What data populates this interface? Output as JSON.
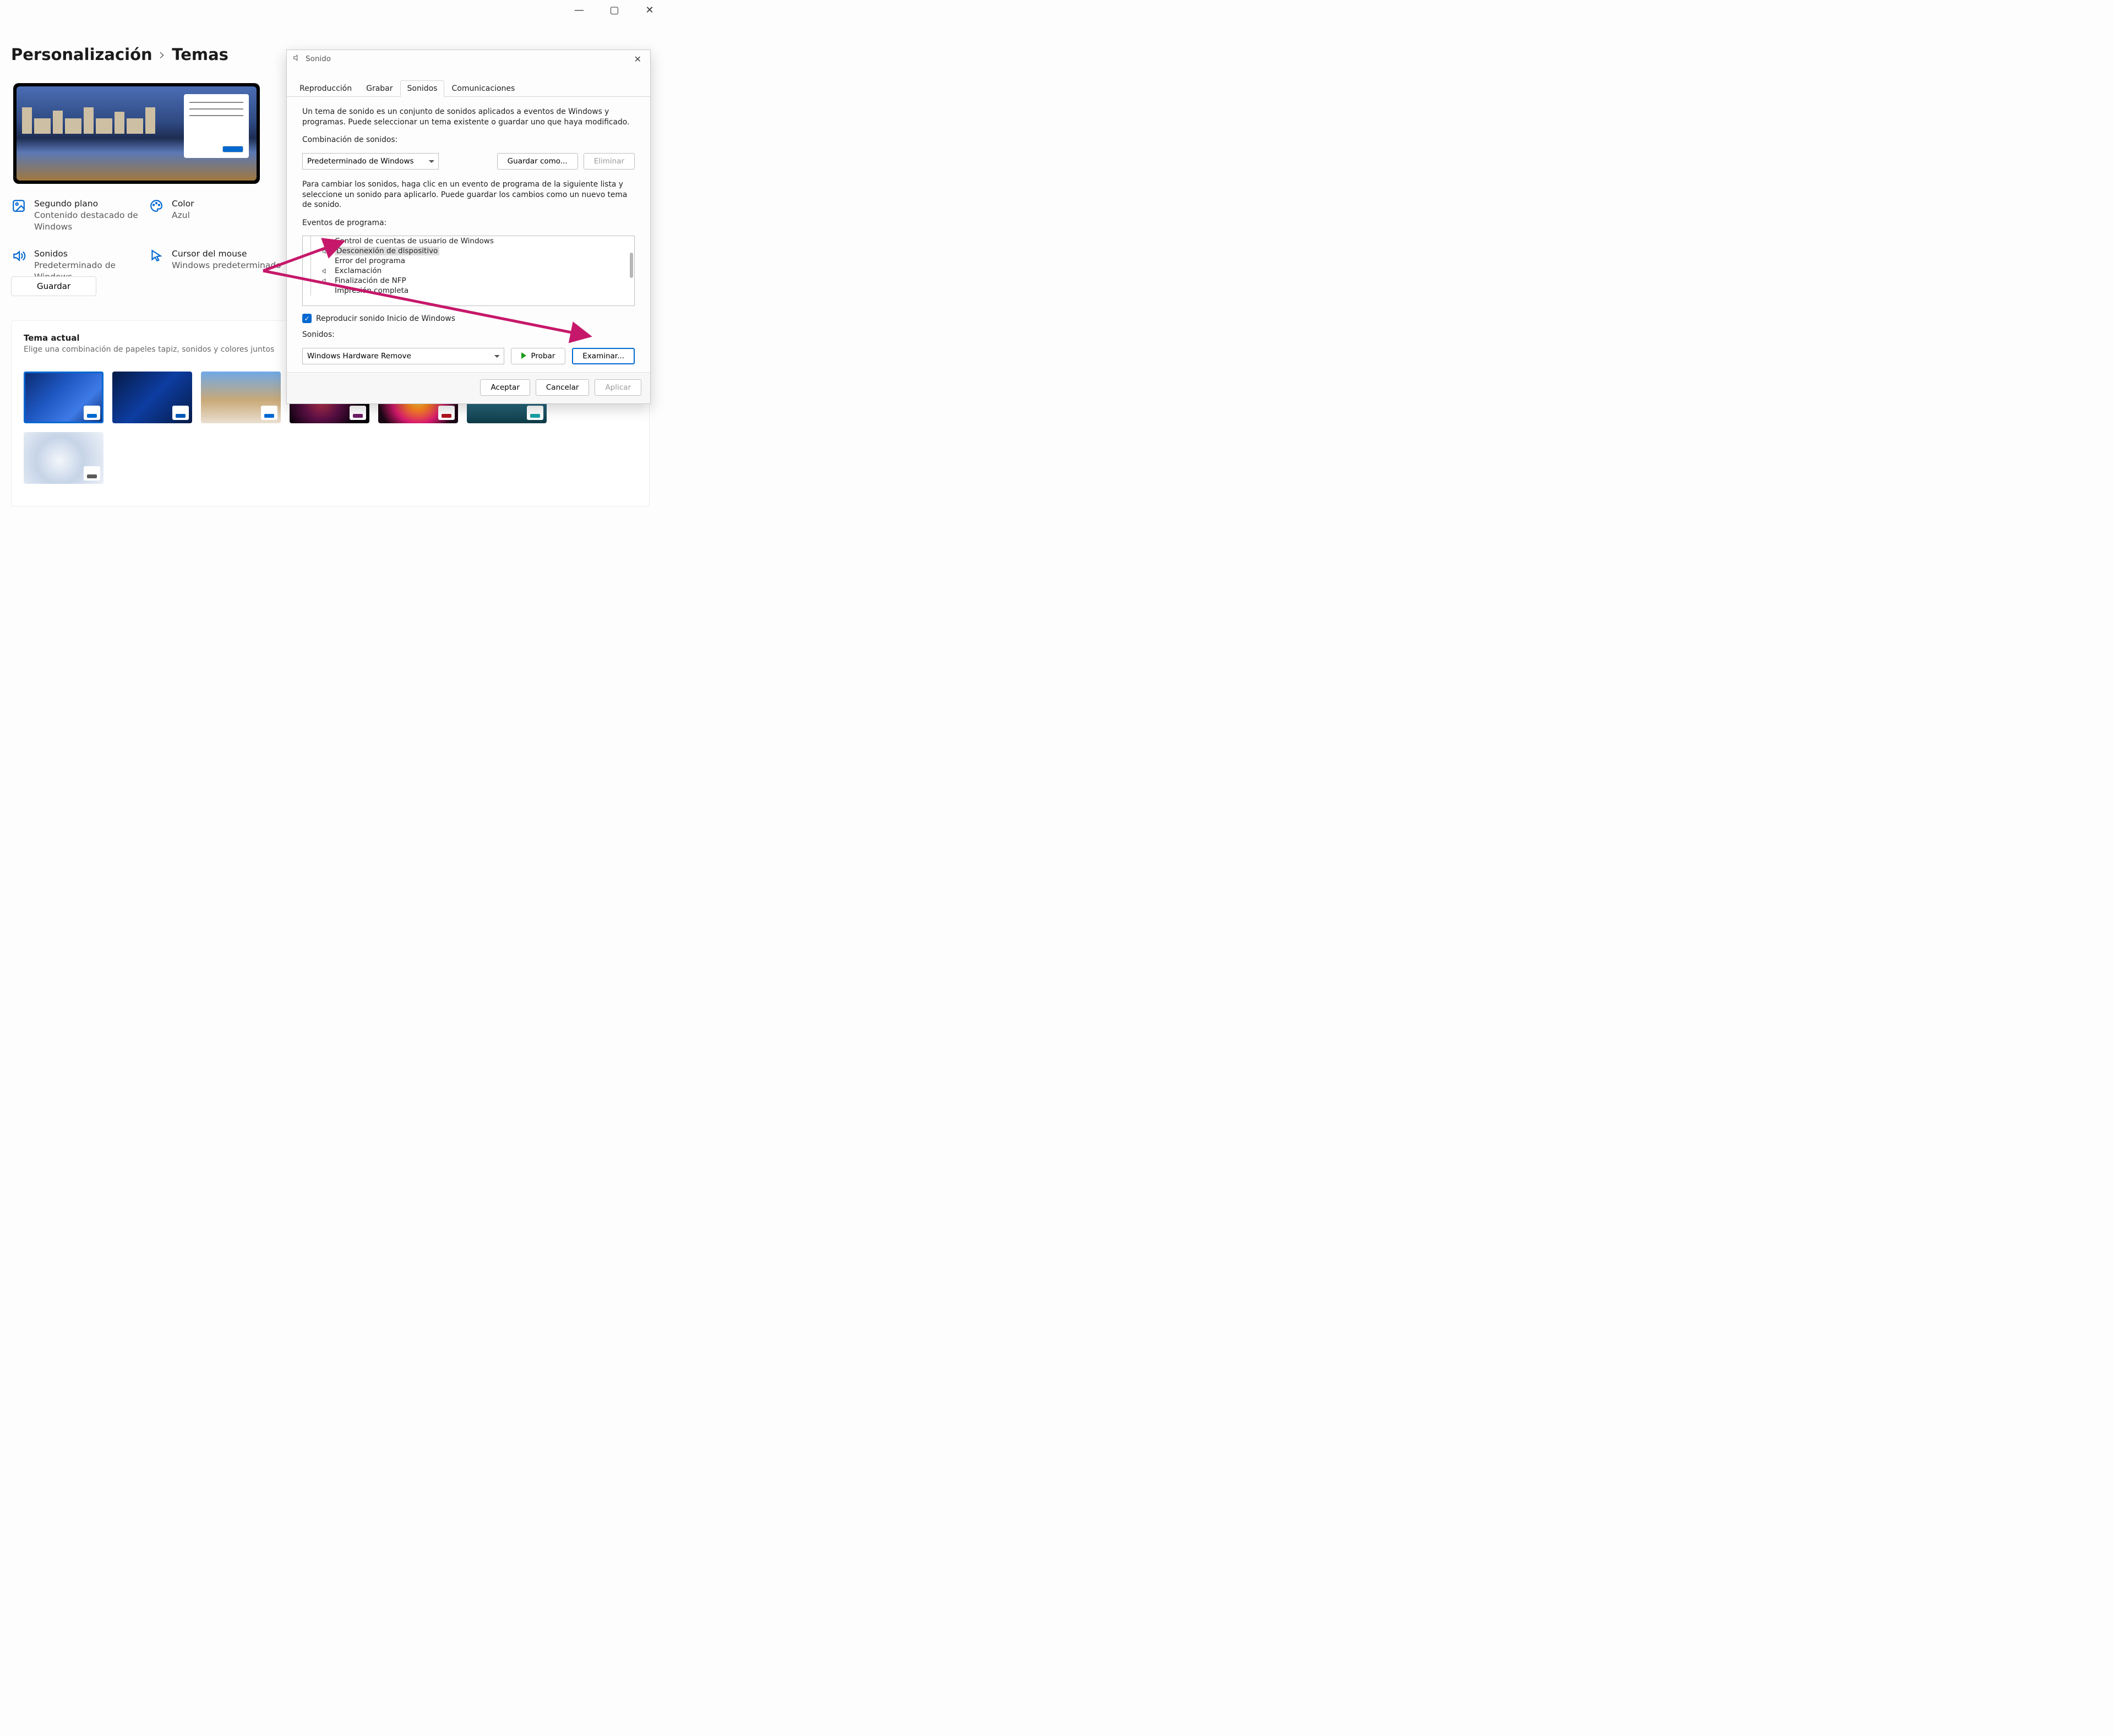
{
  "window_controls": {
    "minimize": "—",
    "maximize": "▢",
    "close": "✕"
  },
  "breadcrumb": {
    "parent": "Personalización",
    "sep": "›",
    "current": "Temas"
  },
  "options": {
    "background": {
      "title": "Segundo plano",
      "value": "Contenido destacado de Windows"
    },
    "color": {
      "title": "Color",
      "value": "Azul"
    },
    "sounds": {
      "title": "Sonidos",
      "value": "Predeterminado de Windows"
    },
    "cursor": {
      "title": "Cursor del mouse",
      "value": "Windows predeterminado"
    }
  },
  "save_button": "Guardar",
  "current_theme": {
    "heading": "Tema actual",
    "sub": "Elige una combinación de papeles tapiz, sonidos y colores juntos"
  },
  "themes": [
    {
      "accent": "#0168d0",
      "bg": "linear-gradient(135deg,#0a2a6e,#1f57c2 40%,#3e7ae6 70%,#0a2a6e)"
    },
    {
      "accent": "#0157b8",
      "bg": "linear-gradient(135deg,#061b47,#0d3da1 50%,#061b47)"
    },
    {
      "accent": "#0168d0",
      "bg": "linear-gradient(180deg,#6fa9e6 0%,#c9a978 55%,#eadfd0 100%)"
    },
    {
      "accent": "#6d1d66",
      "bg": "radial-gradient(circle at 40% 55%,#c1344b 0%,#5a0f45 35%,#060109 70%)"
    },
    {
      "accent": "#b0121e",
      "bg": "radial-gradient(circle at 50% 50%,#ffe24a 0%,#ff8a1e 25%,#d61a6e 55%,#1a0614 85%)"
    },
    {
      "accent": "#1aa0a6",
      "bg": "linear-gradient(180deg,#bfe4ef 0%,#2a6f86 55%,#0f3a46 100%)"
    },
    {
      "accent": "#5a5a5a",
      "bg": "radial-gradient(circle at 45% 55%,#f3f6fb 0%,#c6d4e8 45%,#eef2f8 100%)"
    }
  ],
  "dialog": {
    "title": "Sonido",
    "tabs": [
      "Reproducción",
      "Grabar",
      "Sonidos",
      "Comunicaciones"
    ],
    "active_tab": 2,
    "intro": "Un tema de sonido es un conjunto de sonidos aplicados a eventos de Windows y programas. Puede seleccionar un tema existente o guardar uno que haya modificado.",
    "scheme_label": "Combinación de sonidos:",
    "scheme_value": "Predeterminado de Windows",
    "save_as": "Guardar como...",
    "delete": "Eliminar",
    "events_intro": "Para cambiar los sonidos, haga clic en un evento de programa de la siguiente lista y seleccione un sonido para aplicarlo. Puede guardar los cambios como un nuevo tema de sonido.",
    "events_label": "Eventos de programa:",
    "events": [
      {
        "label": "Control de cuentas de usuario de Windows",
        "has_sound": true
      },
      {
        "label": "Desconexión de dispositivo",
        "has_sound": true,
        "selected": true
      },
      {
        "label": "Error del programa",
        "has_sound": false
      },
      {
        "label": "Exclamación",
        "has_sound": true
      },
      {
        "label": "Finalización de NFP",
        "has_sound": true
      },
      {
        "label": "Impresión completa",
        "has_sound": false
      }
    ],
    "startup_checkbox": "Reproducir sonido Inicio de Windows",
    "sounds_label": "Sonidos:",
    "sound_value": "Windows Hardware Remove",
    "test": "Probar",
    "browse": "Examinar...",
    "ok": "Aceptar",
    "cancel": "Cancelar",
    "apply": "Aplicar"
  }
}
